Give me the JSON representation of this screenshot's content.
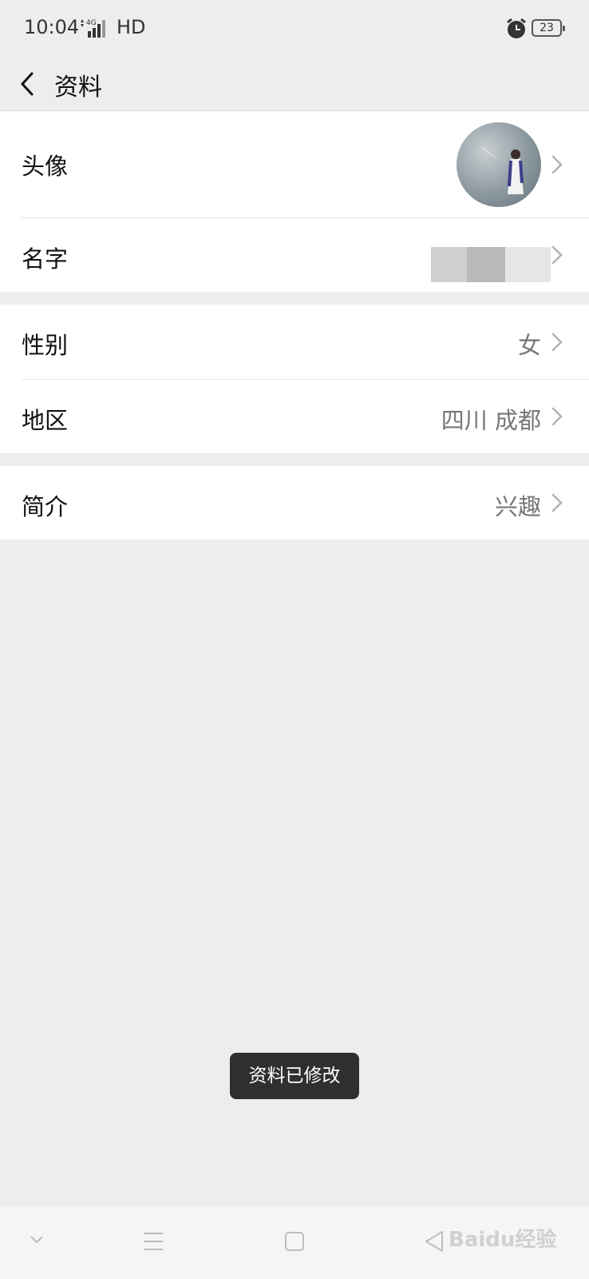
{
  "status_bar": {
    "time": "10:04",
    "network": "4G",
    "hd": "HD",
    "battery": "23"
  },
  "nav": {
    "title": "资料"
  },
  "profile": {
    "avatar_label": "头像",
    "name_label": "名字",
    "gender_label": "性别",
    "gender_value": "女",
    "region_label": "地区",
    "region_value": "四川 成都",
    "bio_label": "简介",
    "bio_value": "兴趣"
  },
  "toast": "资料已修改",
  "watermark": "Baidu经验"
}
